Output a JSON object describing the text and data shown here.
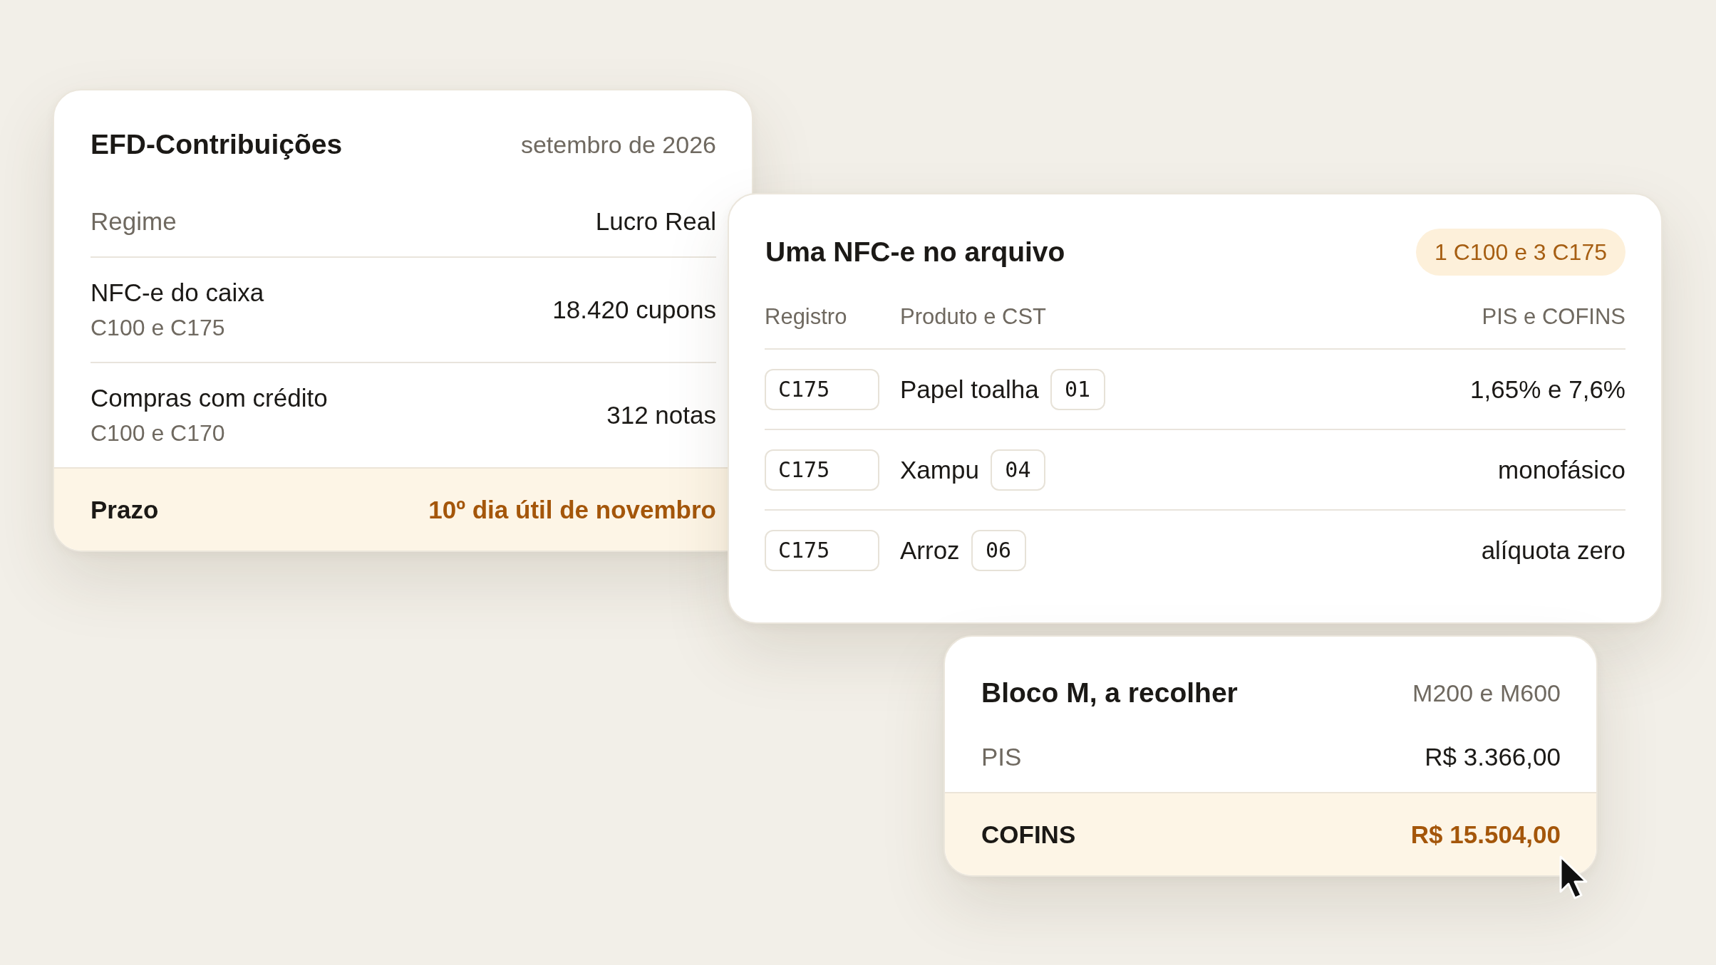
{
  "summary_card": {
    "title": "EFD-Contribuições",
    "period": "setembro de 2026",
    "rows": [
      {
        "kind": "simple",
        "label": "Regime",
        "value": "Lucro Real"
      },
      {
        "kind": "detailed",
        "label": "NFC-e do caixa",
        "sublabel": "C100 e C175",
        "value": "18.420 cupons"
      },
      {
        "kind": "detailed",
        "label": "Compras com crédito",
        "sublabel": "C100 e C170",
        "value": "312 notas"
      }
    ],
    "footer": {
      "label": "Prazo",
      "value": "10º dia útil de novembro"
    }
  },
  "records_card": {
    "title": "Uma NFC-e no arquivo",
    "badge": "1 C100 e 3 C175",
    "columns": [
      "Registro",
      "Produto e CST",
      "PIS e COFINS"
    ],
    "rows": [
      {
        "record": "C175",
        "product": "Papel toalha",
        "cst": "01",
        "rate": "1,65% e 7,6%"
      },
      {
        "record": "C175",
        "product": "Xampu",
        "cst": "04",
        "rate": "monofásico"
      },
      {
        "record": "C175",
        "product": "Arroz",
        "cst": "06",
        "rate": "alíquota zero"
      }
    ]
  },
  "totals_card": {
    "title": "Bloco M, a recolher",
    "records": "M200 e M600",
    "rows": [
      {
        "label": "PIS",
        "value": "R$ 3.366,00"
      }
    ],
    "footer": {
      "label": "COFINS",
      "value": "R$ 15.504,00"
    }
  }
}
